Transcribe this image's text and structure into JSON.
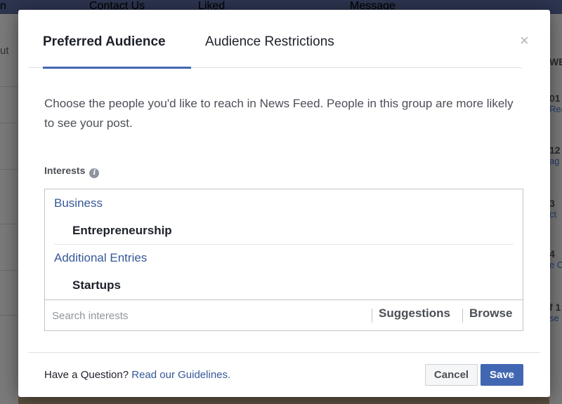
{
  "background": {
    "topbar": {
      "items": [
        "Contact Us",
        "Liked",
        "Message"
      ]
    },
    "left_partial": {
      "text": "ut"
    },
    "right_partial": {
      "header": "WE",
      "rows": [
        {
          "value": "01",
          "sub": "Rea"
        },
        {
          "value": "12",
          "sub": "ag"
        },
        {
          "value": "3",
          "sub": "ct"
        },
        {
          "value": "4",
          "sub": "e C"
        },
        {
          "value": "f 1",
          "sub": "se"
        }
      ]
    }
  },
  "dialog": {
    "tabs": [
      {
        "label": "Preferred Audience",
        "active": true
      },
      {
        "label": "Audience Restrictions",
        "active": false
      }
    ],
    "close_symbol": "×",
    "description": "Choose the people you'd like to reach in News Feed. People in this group are more likely to see your post.",
    "interests": {
      "label": "Interests",
      "info_symbol": "i",
      "groups": [
        {
          "category": "Business",
          "items": [
            "Entrepreneurship"
          ]
        },
        {
          "category": "Additional Entries",
          "items": [
            "Startups"
          ]
        }
      ],
      "search_placeholder": "Search interests",
      "suggestions_label": "Suggestions",
      "browse_label": "Browse"
    },
    "footer": {
      "question": "Have a Question?",
      "guidelines_link": "Read our Guidelines.",
      "cancel_label": "Cancel",
      "save_label": "Save"
    }
  },
  "colors": {
    "accent": "#4267b2",
    "link": "#365899",
    "text": "#1d2129",
    "muted": "#4b4f56"
  }
}
